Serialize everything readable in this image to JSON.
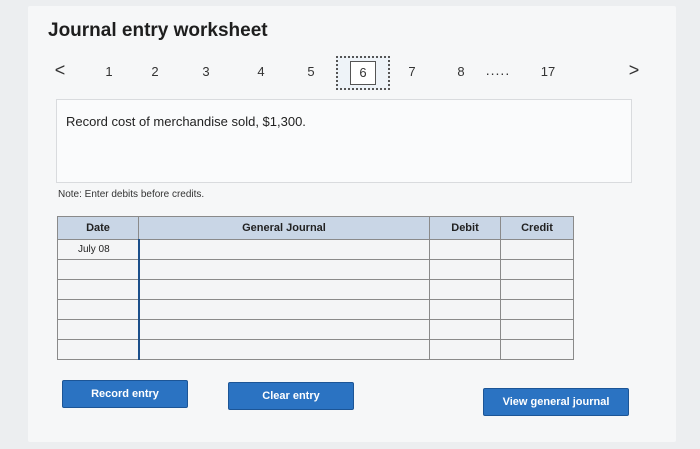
{
  "title": "Journal entry worksheet",
  "pager": {
    "prev": "<",
    "next": ">",
    "pages": [
      "1",
      "2",
      "3",
      "4",
      "5",
      "6",
      "7",
      "8",
      "17"
    ],
    "active": "6",
    "ellipsis": "....."
  },
  "instruction": "Record cost of merchandise sold, $1,300.",
  "note": "Note: Enter debits before credits.",
  "table": {
    "headers": {
      "date": "Date",
      "journal": "General Journal",
      "debit": "Debit",
      "credit": "Credit"
    },
    "rows": [
      {
        "date": "July 08",
        "journal": "",
        "debit": "",
        "credit": ""
      },
      {
        "date": "",
        "journal": "",
        "debit": "",
        "credit": ""
      },
      {
        "date": "",
        "journal": "",
        "debit": "",
        "credit": ""
      },
      {
        "date": "",
        "journal": "",
        "debit": "",
        "credit": ""
      },
      {
        "date": "",
        "journal": "",
        "debit": "",
        "credit": ""
      },
      {
        "date": "",
        "journal": "",
        "debit": "",
        "credit": ""
      }
    ]
  },
  "buttons": {
    "record": "Record entry",
    "clear": "Clear entry",
    "view": "View general journal"
  },
  "colors": {
    "accent": "#2b73c2",
    "header_bg": "#c9d6e6"
  }
}
